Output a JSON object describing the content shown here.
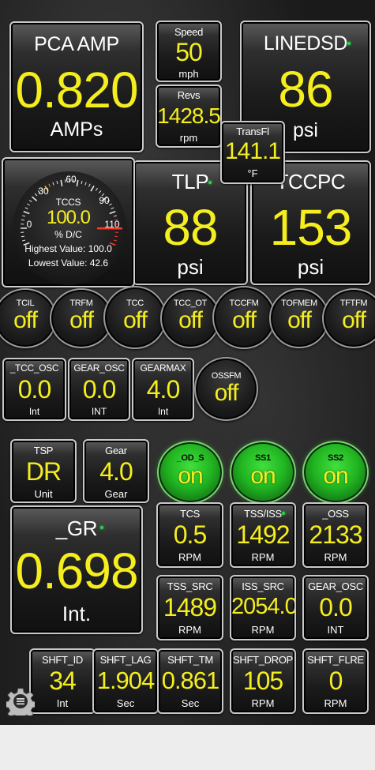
{
  "gauges": {
    "pca_amp": {
      "label": "PCA AMP",
      "value": "0.820",
      "unit": "AMPs"
    },
    "speed": {
      "label": "Speed",
      "value": "50",
      "unit": "mph"
    },
    "revs": {
      "label": "Revs",
      "value": "1428.5",
      "unit": "rpm"
    },
    "linedsd": {
      "label": "LINEDSD",
      "value": "86",
      "unit": "psi"
    },
    "transfl": {
      "label": "TransFl",
      "value": "141.1",
      "unit": "°F"
    },
    "tlp": {
      "label": "TLP",
      "value": "88",
      "unit": "psi"
    },
    "tccpc": {
      "label": "TCCPC",
      "value": "153",
      "unit": "psi"
    },
    "tcc_osc": {
      "label": "_TCC_OSC",
      "value": "0.0",
      "unit": "Int"
    },
    "gear_osc1": {
      "label": "GEAR_OSC",
      "value": "0.0",
      "unit": "INT"
    },
    "gearmax": {
      "label": "GEARMAX",
      "value": "4.0",
      "unit": "Int"
    },
    "tsp": {
      "label": "TSP",
      "value": "DR",
      "unit": "Unit"
    },
    "gear": {
      "label": "Gear",
      "value": "4.0",
      "unit": "Gear"
    },
    "gr": {
      "label": "_GR",
      "value": "0.698",
      "unit": "Int."
    },
    "tcs": {
      "label": "TCS",
      "value": "0.5",
      "unit": "RPM"
    },
    "tss_iss": {
      "label": "TSS/ISS",
      "value": "1492",
      "unit": "RPM"
    },
    "oss": {
      "label": "_OSS",
      "value": "2133",
      "unit": "RPM"
    },
    "tss_src": {
      "label": "TSS_SRC",
      "value": "1489",
      "unit": "RPM"
    },
    "iss_src": {
      "label": "ISS_SRC",
      "value": "2054.0",
      "unit": "RPM"
    },
    "gear_osc2": {
      "label": "GEAR_OSC",
      "value": "0.0",
      "unit": "INT"
    },
    "shft_id": {
      "label": "SHFT_ID",
      "value": "34",
      "unit": "Int"
    },
    "shft_lag": {
      "label": "SHFT_LAG",
      "value": "1.904",
      "unit": "Sec"
    },
    "shft_tm": {
      "label": "SHFT_TM",
      "value": "0.861",
      "unit": "Sec"
    },
    "shft_drop": {
      "label": "SHFT_DROP",
      "value": "105",
      "unit": "RPM"
    },
    "shft_flre": {
      "label": "SHFT_FLRE",
      "value": "0",
      "unit": "RPM"
    }
  },
  "dial": {
    "label": "TCCS",
    "value": "100.0",
    "unit": "% D/C",
    "ticks": [
      "0",
      "30",
      "60",
      "90",
      "110"
    ],
    "highest": "Highest Value: 100.0",
    "lowest": "Lowest Value: 42.6",
    "needle_fraction": 0.91
  },
  "toggles": {
    "tcil": {
      "label": "TCIL",
      "value": "off"
    },
    "trfm": {
      "label": "TRFM",
      "value": "off"
    },
    "tcc": {
      "label": "TCC",
      "value": "off"
    },
    "tcc_ot": {
      "label": "TCC_OT",
      "value": "off"
    },
    "tccfm": {
      "label": "TCCFM",
      "value": "off"
    },
    "tofmem": {
      "label": "TOFMEM",
      "value": "off"
    },
    "tftfm": {
      "label": "TFTFM",
      "value": "off"
    },
    "ossfm": {
      "label": "OSSFM",
      "value": "off"
    },
    "od_s": {
      "label": "_OD_S",
      "value": "on"
    },
    "ss1": {
      "label": "SS1",
      "value": "on"
    },
    "ss2": {
      "label": "SS2",
      "value": "on"
    }
  },
  "icons": {
    "settings": "gear-icon"
  },
  "colors": {
    "value_yellow": "#f5ee1e",
    "on_green": "#27c427",
    "led_green": "#27d642"
  }
}
